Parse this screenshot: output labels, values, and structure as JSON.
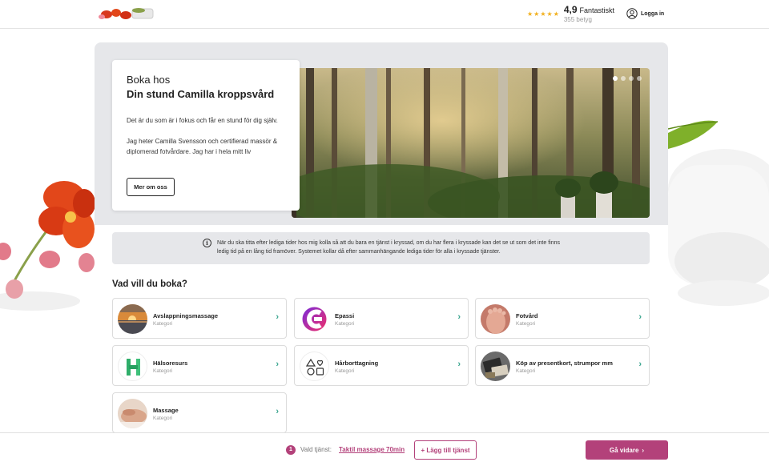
{
  "header": {
    "rating_score": "4,9",
    "rating_word": "Fantastiskt",
    "rating_count": "355 betyg",
    "login_label": "Logga in",
    "stars": 5
  },
  "intro": {
    "pre_title": "Boka hos",
    "title": "Din stund Camilla kroppsvård",
    "paragraph_1": "Det är du som är i fokus och får en stund för dig själv.",
    "paragraph_2": "Jag heter Camilla Svensson och certifierad massör & diplomerad fotvårdare. Jag har i hela mitt liv",
    "more_button": "Mer om oss"
  },
  "carousel": {
    "slides": 4,
    "active_slide": 1
  },
  "info": {
    "text": "När du ska titta efter lediga tider hos mig kolla så att du bara en tjänst i kryssad, om du har flera i kryssade kan det se ut som det inte finns ledig tid på en lång tid framöver. Systemet kollar då efter sammanhängande lediga tider för alla i kryssade tjänster."
  },
  "services": {
    "title": "Vad vill du boka?",
    "items": [
      {
        "name": "Avslappningsmassage",
        "category": "Kategori",
        "icon": "sunset-photo"
      },
      {
        "name": "Epassi",
        "category": "Kategori",
        "icon": "epassi-logo"
      },
      {
        "name": "Fotvård",
        "category": "Kategori",
        "icon": "foot-photo"
      },
      {
        "name": "Hälsoresurs",
        "category": "Kategori",
        "icon": "halsoresurs-logo"
      },
      {
        "name": "Hårborttagning",
        "category": "Kategori",
        "icon": "shapes-icon"
      },
      {
        "name": "Köp av presentkort, strumpor mm",
        "category": "Kategori",
        "icon": "giftcard-photo"
      },
      {
        "name": "Massage",
        "category": "Kategori",
        "icon": "massage-photo"
      }
    ]
  },
  "bottom_bar": {
    "step": "1",
    "chosen_label": "Vald tjänst:",
    "chosen_value": "Taktil massage 70min",
    "add_button": "+ Lägg till tjänst",
    "continue_button": "Gå vidare"
  },
  "colors": {
    "accent": "#b3417a",
    "chevron": "#3aa58f",
    "star": "#f2b01e",
    "band": "#e6e7ea"
  }
}
